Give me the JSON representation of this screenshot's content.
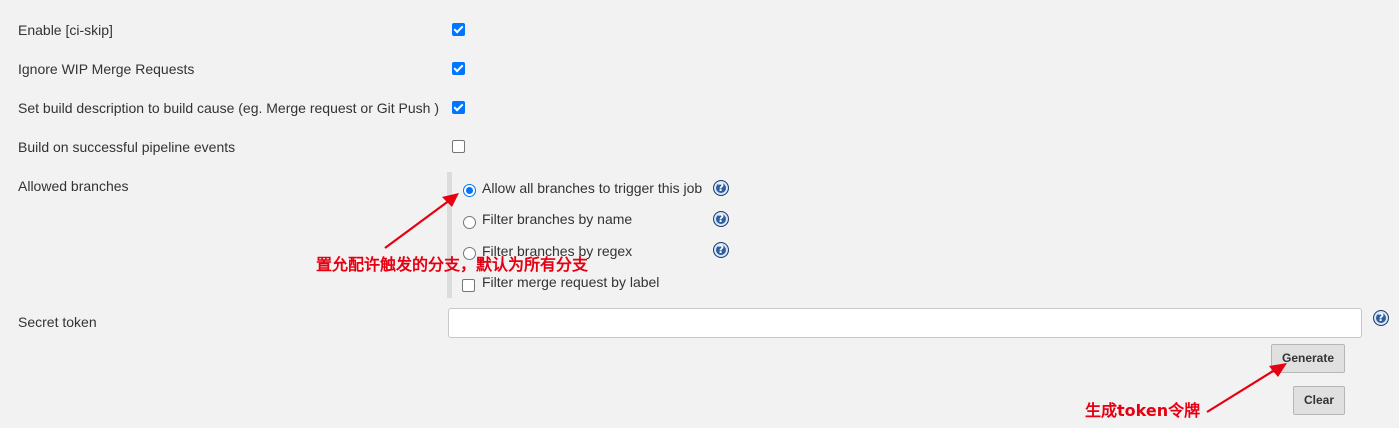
{
  "settings": {
    "enable_ci_skip": {
      "label": "Enable [ci-skip]",
      "checked": true
    },
    "ignore_wip": {
      "label": "Ignore WIP Merge Requests",
      "checked": true
    },
    "set_build_description": {
      "label": "Set build description to build cause (eg. Merge request or Git Push )",
      "checked": true
    },
    "build_on_pipeline": {
      "label": "Build on successful pipeline events",
      "checked": false
    }
  },
  "allowed_branches": {
    "label": "Allowed branches",
    "options": [
      {
        "label": "Allow all branches to trigger this job",
        "selected": true
      },
      {
        "label": "Filter branches by name",
        "selected": false
      },
      {
        "label": "Filter branches by regex",
        "selected": false
      }
    ],
    "filter_merge_by_label": {
      "label": "Filter merge request by label",
      "checked": false
    }
  },
  "secret_token": {
    "label": "Secret token",
    "value": "",
    "generate_label": "Generate",
    "clear_label": "Clear"
  },
  "help_symbol": "?",
  "annotations": {
    "branches_note": "置允配许触发的分支，默认为所有分支",
    "token_note": "生成token令牌"
  },
  "colors": {
    "background": "#f2f2f2",
    "accent": "#0075ff",
    "annotation": "#e60012",
    "help_icon": "#2d5f9e"
  }
}
